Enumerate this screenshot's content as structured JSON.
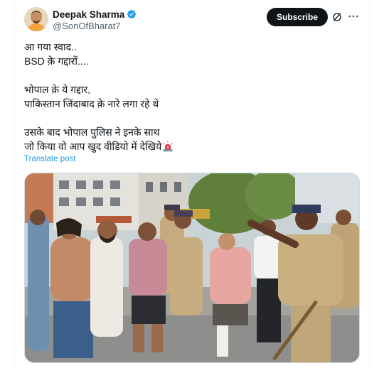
{
  "post": {
    "author": {
      "display_name": "Deepak Sharma",
      "handle": "@SonOfBharat7",
      "verified_icon": "verified-badge-icon"
    },
    "subscribe_label": "Subscribe",
    "icons": [
      "grok-icon",
      "more-options-icon"
    ],
    "text_lines": [
      "आ गया स्वाद..",
      "BSD क़े गद्दारों....",
      "",
      "भोपाल क़े ये गद्दार,",
      "पाकिस्तान जिंदाबाद क़े नारे लगा रहे थे",
      "",
      "उसके बाद भोपाल पुलिस ने इनके साथ",
      "जो किया वो आप खुद वीडियो में देखिये"
    ],
    "emoji": "police-light-emoji",
    "translate_label": "Translate post",
    "media": {
      "type": "video-frame",
      "description_icon": "photo-street-police-scene"
    }
  },
  "colors": {
    "text": "#0f1419",
    "secondary": "#536471",
    "link": "#1d9bf0",
    "button_bg": "#0f1419",
    "verified": "#1d9bf0"
  }
}
